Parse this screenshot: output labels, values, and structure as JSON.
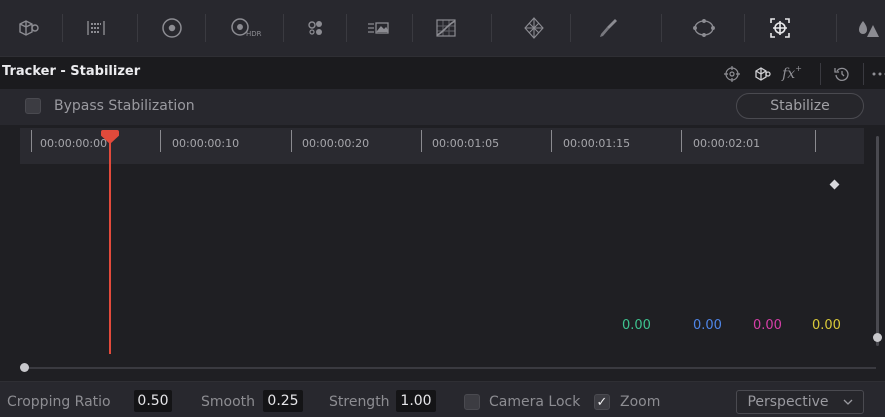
{
  "toolbar": {
    "tools": [
      "camera-raw-icon",
      "color-match-icon",
      "primaries-wheels-icon",
      "hdr-wheels-icon",
      "rgb-mixer-icon",
      "motion-effects-icon",
      "curves-icon",
      "color-warper-icon",
      "qualifier-icon",
      "window-icon",
      "tracker-icon",
      "magic-mask-icon"
    ],
    "hdr_label": "HDR"
  },
  "panel": {
    "title": "Tracker - Stabilizer",
    "header_icons": [
      "crosshair-icon",
      "cloud-tracker-icon",
      "fx-icon",
      "reset-icon",
      "more-icon"
    ],
    "fx_label": "fx"
  },
  "bypass": {
    "label": "Bypass Stabilization",
    "checked": false
  },
  "stabilize_button": "Stabilize",
  "timeline": {
    "timecodes": [
      "00:00:00:00",
      "00:00:00:10",
      "00:00:00:20",
      "00:00:01:05",
      "00:00:01:15",
      "00:00:02:01"
    ],
    "values": [
      "0.00",
      "0.00",
      "0.00",
      "0.00"
    ],
    "value_colors": [
      "#3ec28f",
      "#4f86e8",
      "#d63fa8",
      "#d9c93a"
    ],
    "playhead_color": "#e24a3b"
  },
  "controls": {
    "cropping_ratio_label": "Cropping Ratio",
    "cropping_ratio": "0.50",
    "smooth_label": "Smooth",
    "smooth": "0.25",
    "strength_label": "Strength",
    "strength": "1.00",
    "camera_lock_label": "Camera Lock",
    "camera_lock_checked": false,
    "zoom_label": "Zoom",
    "zoom_checked": true,
    "mode": "Perspective"
  }
}
